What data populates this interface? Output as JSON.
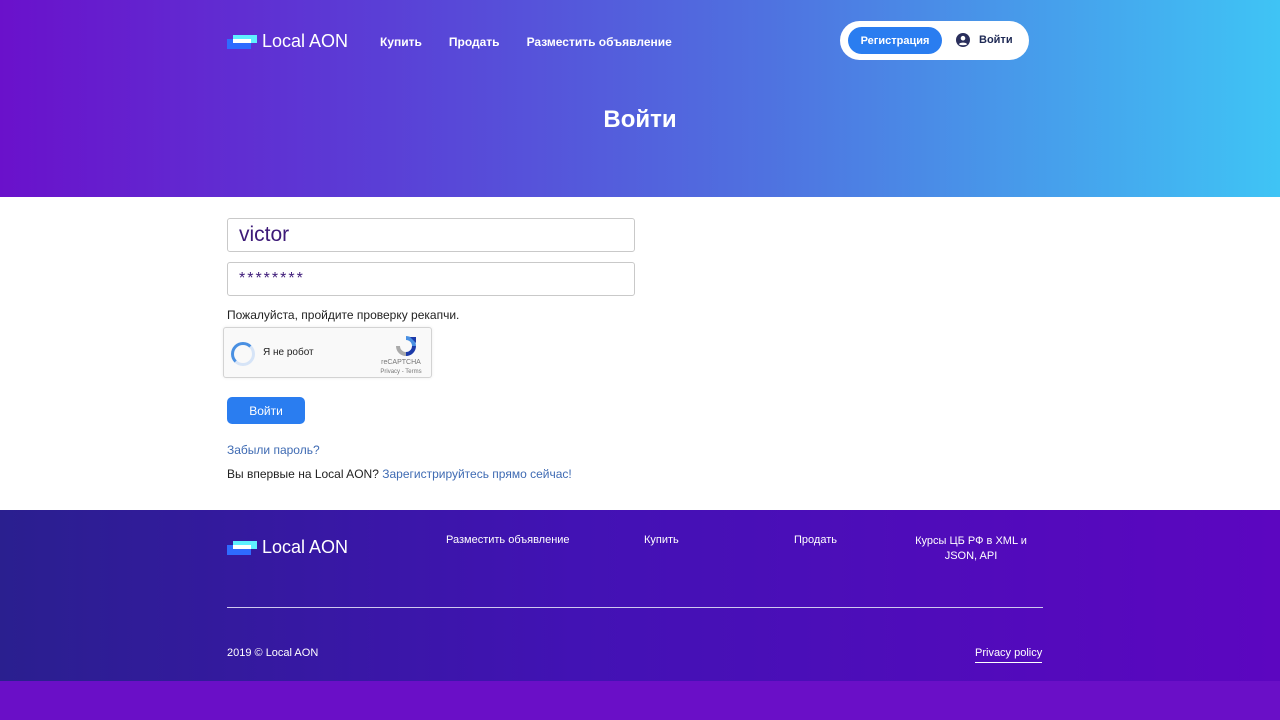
{
  "brand": {
    "name": "Local AON"
  },
  "header": {
    "nav": [
      "Купить",
      "Продать",
      "Разместить объявление"
    ],
    "register_label": "Регистрация",
    "login_label": "Войти",
    "page_title": "Войти"
  },
  "form": {
    "username_value": "victor",
    "password_value": "********",
    "captcha_note": "Пожалуйста, пройдите проверку рекапчи.",
    "recaptcha": {
      "label": "Я не робот",
      "brand": "reCAPTCHA",
      "terms": "Privacy - Terms"
    },
    "submit_label": "Войти",
    "forgot_label": "Забыли пароль?",
    "new_user_prefix": "Вы впервые на Local AON?",
    "register_now_label": "Зарегистрируйтесь прямо сейчас!"
  },
  "footer": {
    "nav": [
      "Разместить объявление",
      "Купить",
      "Продать",
      "Курсы ЦБ РФ в XML и JSON, API"
    ],
    "copyright": "2019 © Local AON",
    "privacy_label": "Privacy policy"
  },
  "colors": {
    "accent": "#2a7df0",
    "link": "#3f6bb3",
    "hero_start": "#6a11cb",
    "hero_end": "#3fc4f5",
    "footer_bg": "#4212b4"
  }
}
